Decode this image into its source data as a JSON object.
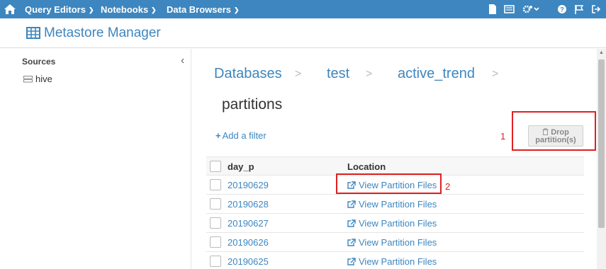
{
  "nav": {
    "items": [
      {
        "label": "Query Editors"
      },
      {
        "label": "Notebooks"
      },
      {
        "label": "Data Browsers"
      }
    ],
    "right_icons": [
      "document-icon",
      "jobs-icon",
      "settings-gear-icon",
      "help-icon",
      "flag-icon",
      "logout-icon"
    ]
  },
  "header": {
    "title": "Metastore Manager",
    "icon": "table-grid-icon"
  },
  "sidebar": {
    "heading": "Sources",
    "items": [
      {
        "label": "hive",
        "icon": "database-server-icon"
      }
    ]
  },
  "breadcrumb": {
    "items": [
      "Databases",
      "test",
      "active_trend"
    ],
    "separator": ">"
  },
  "page_title": "partitions",
  "add_filter_label": "Add a filter",
  "drop_button": {
    "label_line1": "Drop",
    "label_line2": "partition(s)"
  },
  "annotations": {
    "marker_1": "1",
    "marker_2": "2"
  },
  "table": {
    "columns": [
      "day_p",
      "Location"
    ],
    "rows": [
      {
        "day_p": "20190629",
        "location": "View Partition Files"
      },
      {
        "day_p": "20190628",
        "location": "View Partition Files"
      },
      {
        "day_p": "20190627",
        "location": "View Partition Files"
      },
      {
        "day_p": "20190626",
        "location": "View Partition Files"
      },
      {
        "day_p": "20190625",
        "location": "View Partition Files"
      }
    ]
  },
  "colors": {
    "brand": "#3d86bf",
    "annotation": "#e02020"
  }
}
